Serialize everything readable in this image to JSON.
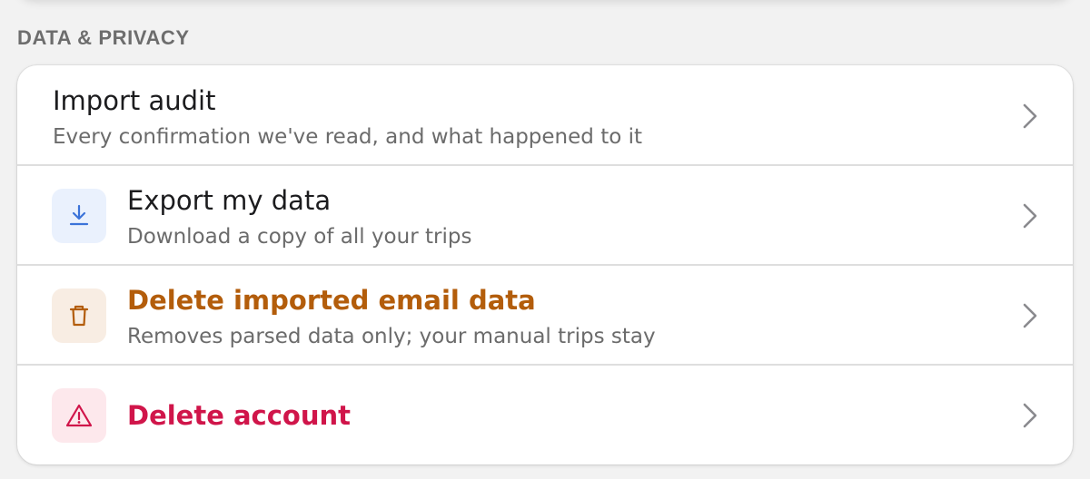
{
  "section": {
    "title": "DATA & PRIVACY"
  },
  "rows": [
    {
      "title": "Import audit",
      "subtitle": "Every confirmation we've read, and what happened to it"
    },
    {
      "title": "Export my data",
      "subtitle": "Download a copy of all your trips",
      "icon": "download-icon"
    },
    {
      "title": "Delete imported email data",
      "subtitle": "Removes parsed data only; your manual trips stay",
      "icon": "trash-icon"
    },
    {
      "title": "Delete account",
      "icon": "warning-icon"
    }
  ],
  "colors": {
    "background": "#f2f2f2",
    "card": "#ffffff",
    "section_header": "#6d6d6d",
    "title_default": "#1c1c1e",
    "subtitle": "#6b6b6b",
    "export_accent": "#3b73d9",
    "export_icon_bg": "#eaf1fd",
    "delete_email_accent": "#b35d0b",
    "delete_email_icon_bg": "#f8ede3",
    "delete_account_accent": "#d0154a",
    "delete_account_icon_bg": "#fde8ec",
    "chevron": "#8a8a8e"
  }
}
